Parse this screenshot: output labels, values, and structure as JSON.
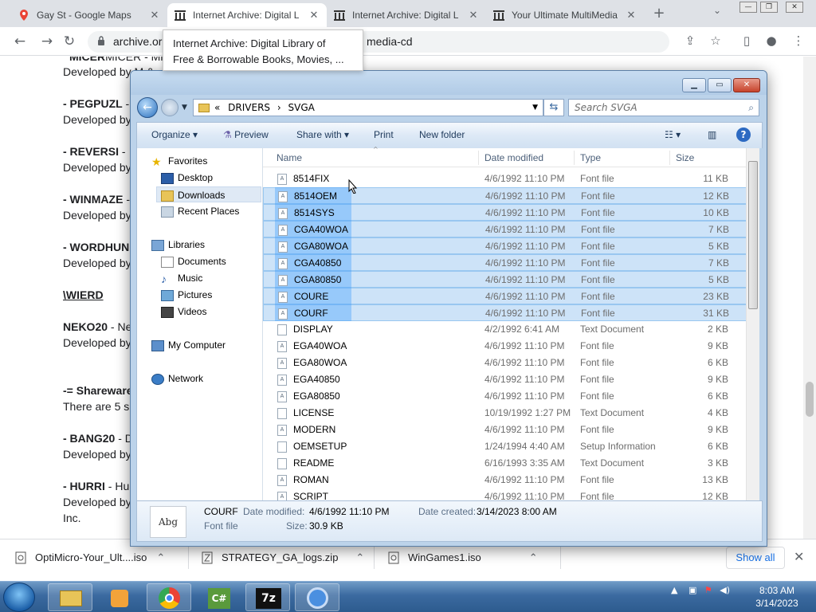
{
  "browser": {
    "tabs": [
      {
        "title": "Gay St - Google Maps",
        "active": false
      },
      {
        "title": "Internet Archive: Digital L",
        "active": true
      },
      {
        "title": "Internet Archive: Digital L",
        "active": false
      },
      {
        "title": "Your Ultimate MultiMedia",
        "active": false
      }
    ],
    "url_prefix": "archive.or",
    "url_suffix": "media-cd",
    "tooltip_line1": "Internet Archive: Digital Library of",
    "tooltip_line2": "Free & Borrowable Books, Movies, ..."
  },
  "page": {
    "lines": [
      {
        "text": "MICER - Misc",
        "bold": "MICER"
      },
      {
        "text": "Developed by M & "
      },
      {
        "bold": "- PEGPUZL",
        "text": " - "
      },
      {
        "text": "Developed by"
      },
      {
        "bold": "- REVERSI",
        "text": " - "
      },
      {
        "text": "Developed by"
      },
      {
        "bold": "- WINMAZE",
        "text": " - "
      },
      {
        "text": "Developed by"
      },
      {
        "bold": "- WORDHUN",
        "text": ""
      },
      {
        "text": "Developed by"
      },
      {
        "heading": "\\WIERD"
      },
      {
        "bold": "NEKO20",
        "text": " - Ne"
      },
      {
        "text": "Developed by"
      },
      {
        "bold": "-= Shareware",
        "text": ""
      },
      {
        "text": "There are 5 s"
      },
      {
        "bold": "- BANG20",
        "text": " - D"
      },
      {
        "text": "Developed by"
      },
      {
        "bold": "- HURRI",
        "text": " - Hu"
      },
      {
        "text": "Developed by"
      },
      {
        "text": "Inc."
      }
    ]
  },
  "explorer": {
    "breadcrumb": [
      "DRIVERS",
      "SVGA"
    ],
    "search_placeholder": "Search SVGA",
    "toolbar": {
      "organize": "Organize",
      "preview": "Preview",
      "share_with": "Share with",
      "print": "Print",
      "new_folder": "New folder"
    },
    "nav": {
      "favorites": "Favorites",
      "desktop": "Desktop",
      "downloads": "Downloads",
      "recent_places": "Recent Places",
      "libraries": "Libraries",
      "documents": "Documents",
      "music": "Music",
      "pictures": "Pictures",
      "videos": "Videos",
      "my_computer": "My Computer",
      "network": "Network"
    },
    "columns": {
      "name": "Name",
      "date": "Date modified",
      "type": "Type",
      "size": "Size"
    },
    "files": [
      {
        "name": "8514FIX",
        "date": "4/6/1992 11:10 PM",
        "type": "Font file",
        "size": "11 KB",
        "selected": false
      },
      {
        "name": "8514OEM",
        "date": "4/6/1992 11:10 PM",
        "type": "Font file",
        "size": "12 KB",
        "selected": true
      },
      {
        "name": "8514SYS",
        "date": "4/6/1992 11:10 PM",
        "type": "Font file",
        "size": "10 KB",
        "selected": true
      },
      {
        "name": "CGA40WOA",
        "date": "4/6/1992 11:10 PM",
        "type": "Font file",
        "size": "7 KB",
        "selected": true
      },
      {
        "name": "CGA80WOA",
        "date": "4/6/1992 11:10 PM",
        "type": "Font file",
        "size": "5 KB",
        "selected": true
      },
      {
        "name": "CGA40850",
        "date": "4/6/1992 11:10 PM",
        "type": "Font file",
        "size": "7 KB",
        "selected": true
      },
      {
        "name": "CGA80850",
        "date": "4/6/1992 11:10 PM",
        "type": "Font file",
        "size": "5 KB",
        "selected": true
      },
      {
        "name": "COURE",
        "date": "4/6/1992 11:10 PM",
        "type": "Font file",
        "size": "23 KB",
        "selected": true
      },
      {
        "name": "COURF",
        "date": "4/6/1992 11:10 PM",
        "type": "Font file",
        "size": "31 KB",
        "selected": true
      },
      {
        "name": "DISPLAY",
        "date": "4/2/1992 6:41 AM",
        "type": "Text Document",
        "size": "2 KB",
        "selected": false
      },
      {
        "name": "EGA40WOA",
        "date": "4/6/1992 11:10 PM",
        "type": "Font file",
        "size": "9 KB",
        "selected": false
      },
      {
        "name": "EGA80WOA",
        "date": "4/6/1992 11:10 PM",
        "type": "Font file",
        "size": "6 KB",
        "selected": false
      },
      {
        "name": "EGA40850",
        "date": "4/6/1992 11:10 PM",
        "type": "Font file",
        "size": "9 KB",
        "selected": false
      },
      {
        "name": "EGA80850",
        "date": "4/6/1992 11:10 PM",
        "type": "Font file",
        "size": "6 KB",
        "selected": false
      },
      {
        "name": "LICENSE",
        "date": "10/19/1992 1:27 PM",
        "type": "Text Document",
        "size": "4 KB",
        "selected": false
      },
      {
        "name": "MODERN",
        "date": "4/6/1992 11:10 PM",
        "type": "Font file",
        "size": "9 KB",
        "selected": false
      },
      {
        "name": "OEMSETUP",
        "date": "1/24/1994 4:40 AM",
        "type": "Setup Information",
        "size": "6 KB",
        "selected": false
      },
      {
        "name": "README",
        "date": "6/16/1993 3:35 AM",
        "type": "Text Document",
        "size": "3 KB",
        "selected": false
      },
      {
        "name": "ROMAN",
        "date": "4/6/1992 11:10 PM",
        "type": "Font file",
        "size": "13 KB",
        "selected": false
      },
      {
        "name": "SCRIPT",
        "date": "4/6/1992 11:10 PM",
        "type": "Font file",
        "size": "12 KB",
        "selected": false
      }
    ],
    "details": {
      "thumb": "Abg",
      "name": "COURF",
      "type": "Font file",
      "modified_label": "Date modified:",
      "modified": "4/6/1992 11:10 PM",
      "created_label": "Date created:",
      "created": "3/14/2023 8:00 AM",
      "size_label": "Size:",
      "size": "30.9 KB"
    }
  },
  "downloads": [
    {
      "name": "OptiMicro-Your_Ult....iso"
    },
    {
      "name": "STRATEGY_GA_logs.zip"
    },
    {
      "name": "WinGames1.iso"
    }
  ],
  "show_all": "Show all",
  "clock": {
    "time": "8:03 AM",
    "date": "3/14/2023"
  }
}
